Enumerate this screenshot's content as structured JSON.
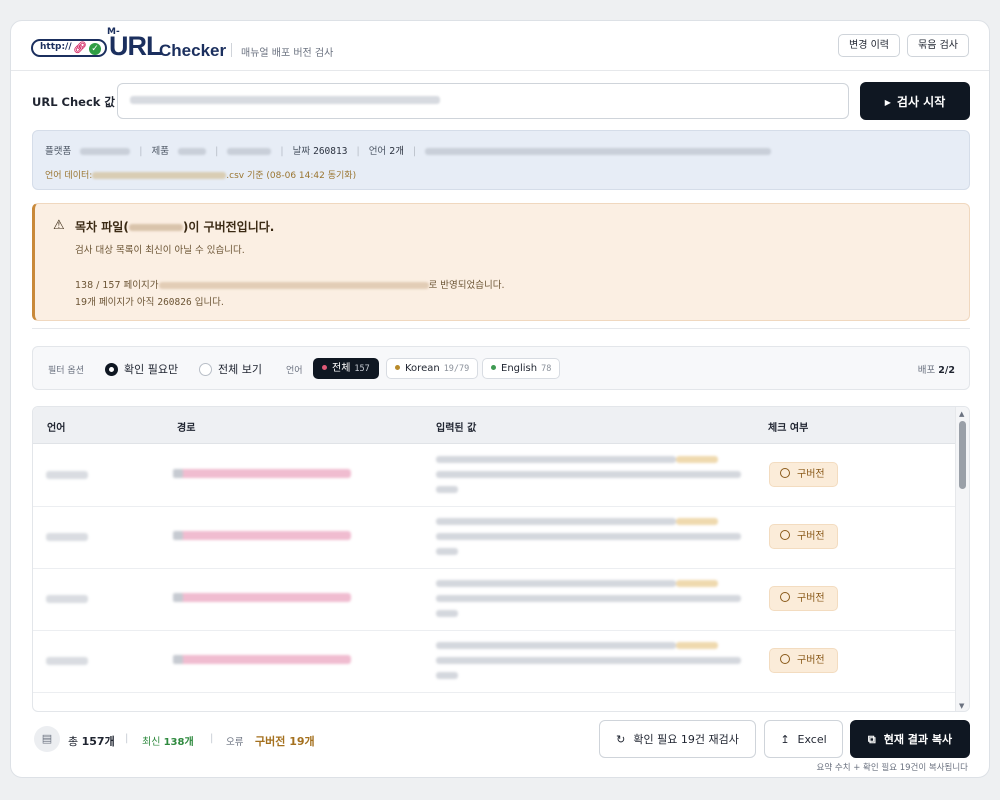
{
  "header": {
    "logo_http": "http://",
    "logo_m": "M-",
    "logo_url": "URL",
    "logo_checker": "Checker",
    "subtitle": "매뉴얼 배포 버전 검사",
    "history_button": "변경 이력",
    "batch_button": "묶음 검사"
  },
  "url_check": {
    "label": "URL Check 값",
    "start_button": "검사 시작"
  },
  "info": {
    "platform_label": "플랫폼",
    "product_label": "제품",
    "date_label": "날짜",
    "date_value": "260813",
    "language_label": "언어",
    "language_value": "2개",
    "lang_data_prefix": "언어 데이터:",
    "lang_data_suffix": ".csv 기준 (08-06 14:42 동기화)"
  },
  "warning": {
    "title_prefix": "목차 파일",
    "title_suffix": ")이 구버전입니다.",
    "line1": "검사 대상 목록이 최신이 아닐 수 있습니다.",
    "line2_prefix": "138 / 157 페이지가",
    "line2_suffix": "로 반영되었습니다.",
    "line3_prefix": "19개 페이지가 아직",
    "line3_code": "260826",
    "line3_suffix": "입니다."
  },
  "filter": {
    "label": "필터 옵션",
    "option_needs_check": "확인 필요만",
    "option_show_all": "전체 보기",
    "language_label": "언어",
    "chips": [
      {
        "label": "전체",
        "count": "157",
        "dot_color": "#e05a77"
      },
      {
        "label": "Korean",
        "count": "19/79",
        "dot_color": "#b88a2a"
      },
      {
        "label": "English",
        "count": "78",
        "dot_color": "#3f9a52"
      }
    ],
    "deploy_label": "배포",
    "deploy_value": "2/2"
  },
  "table": {
    "columns": [
      "언어",
      "경로",
      "입력된 값",
      "체크 여부"
    ],
    "rows": [
      {
        "status": "구버전"
      },
      {
        "status": "구버전"
      },
      {
        "status": "구버전"
      },
      {
        "status": "구버전"
      }
    ]
  },
  "footer": {
    "total_label": "총",
    "total_value": "157개",
    "new_label": "최신",
    "new_value": "138개",
    "error_label": "오류",
    "old_label": "구버전",
    "old_value": "19개",
    "recheck_button": "확인 필요 19건 재검사",
    "excel_button": "Excel",
    "copy_button": "현재 결과 복사",
    "copy_note": "요약 수치 + 확인 필요 19건이 복사됩니다"
  },
  "colors": {
    "primary_dark": "#0f1722",
    "warning_bg": "#fbefe3",
    "info_bg": "#e7edf6",
    "status_old": "#a4701e",
    "status_new": "#2f8a3f"
  }
}
